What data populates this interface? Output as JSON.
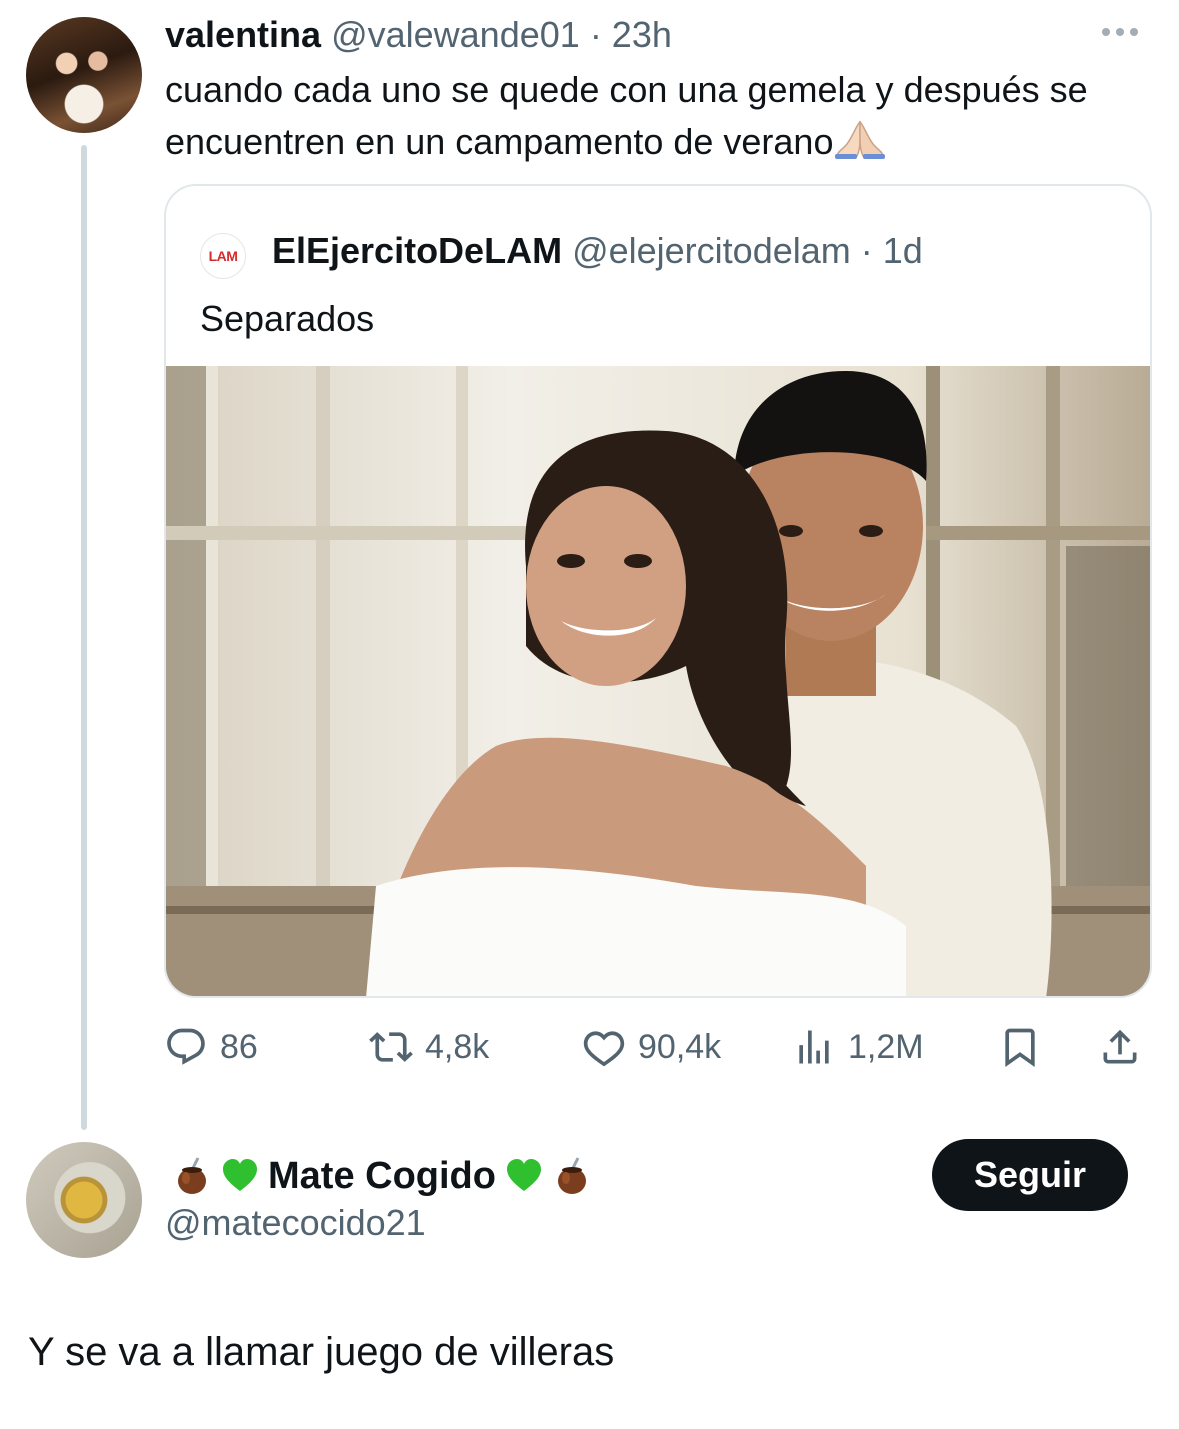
{
  "tweet1": {
    "display_name": "valentina",
    "handle": "@valewande01",
    "time": "· 23h",
    "text": "cuando cada uno se quede con una gemela y después se encuentren en un campamento de verano",
    "emoji_icon": "folded-hands-icon"
  },
  "quoted": {
    "logo_text": "LAM",
    "display_name": "ElEjercitoDeLAM",
    "handle": "@elejercitodelam",
    "time": "· 1d",
    "text": "Separados"
  },
  "actions": {
    "replies": "86",
    "retweets": "4,8k",
    "likes": "90,4k",
    "views": "1,2M"
  },
  "tweet2": {
    "display_name": "Mate Cogido",
    "handle": "@matecocido21",
    "follow_label": "Seguir",
    "text": "Y se va a llamar juego de villeras",
    "name_emojis": [
      "mate-icon",
      "green-heart-icon",
      "green-heart-icon",
      "mate-icon"
    ]
  },
  "colors": {
    "muted": "#536471",
    "text": "#0f1419",
    "border": "#e1e7ea",
    "button_bg": "#0f1419"
  }
}
